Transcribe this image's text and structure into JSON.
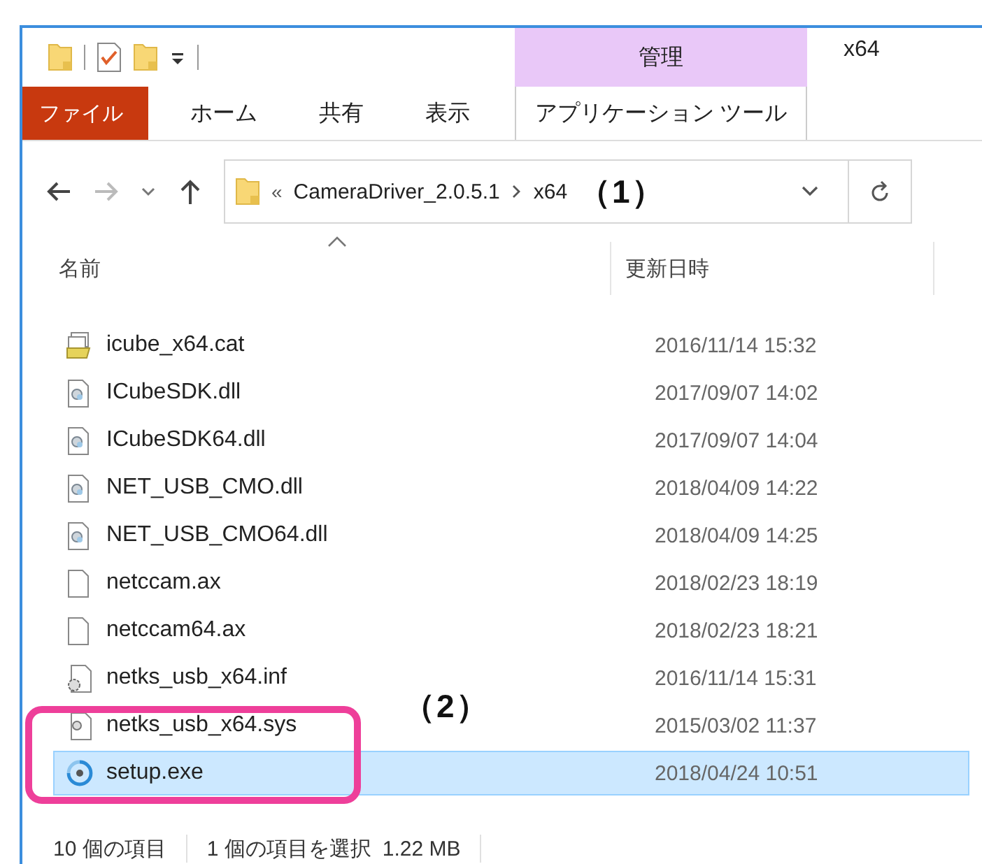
{
  "window": {
    "title": "x64"
  },
  "context_tab": {
    "group": "管理",
    "label": "アプリケーション ツール"
  },
  "ribbon_tabs": [
    {
      "label": "ファイル",
      "kind": "file"
    },
    {
      "label": "ホーム",
      "kind": "tab"
    },
    {
      "label": "共有",
      "kind": "tab"
    },
    {
      "label": "表示",
      "kind": "tab"
    }
  ],
  "address": {
    "overflow": "«",
    "segments": [
      "CameraDriver_2.0.5.1",
      "x64"
    ],
    "annotation": "（1）"
  },
  "columns": [
    {
      "label": "名前",
      "sorted": true
    },
    {
      "label": "更新日時",
      "sorted": false
    }
  ],
  "files": [
    {
      "name": "icube_x64.cat",
      "modified": "2016/11/14 15:32",
      "kind": "catalog",
      "selected": false
    },
    {
      "name": "ICubeSDK.dll",
      "modified": "2017/09/07 14:02",
      "kind": "dll",
      "selected": false
    },
    {
      "name": "ICubeSDK64.dll",
      "modified": "2017/09/07 14:04",
      "kind": "dll",
      "selected": false
    },
    {
      "name": "NET_USB_CMO.dll",
      "modified": "2018/04/09 14:22",
      "kind": "dll",
      "selected": false
    },
    {
      "name": "NET_USB_CMO64.dll",
      "modified": "2018/04/09 14:25",
      "kind": "dll",
      "selected": false
    },
    {
      "name": "netccam.ax",
      "modified": "2018/02/23 18:19",
      "kind": "blank",
      "selected": false
    },
    {
      "name": "netccam64.ax",
      "modified": "2018/02/23 18:21",
      "kind": "blank",
      "selected": false
    },
    {
      "name": "netks_usb_x64.inf",
      "modified": "2016/11/14 15:31",
      "kind": "inf",
      "selected": false
    },
    {
      "name": "netks_usb_x64.sys",
      "modified": "2015/03/02 11:37",
      "kind": "sys",
      "selected": false
    },
    {
      "name": "setup.exe",
      "modified": "2018/04/24 10:51",
      "kind": "exe",
      "selected": true
    }
  ],
  "highlight": {
    "annotation": "（2）",
    "color": "#ee3f9a"
  },
  "status_bar": {
    "count": "10 個の項目",
    "selection": "1 個の項目を選択",
    "size": "1.22 MB"
  }
}
